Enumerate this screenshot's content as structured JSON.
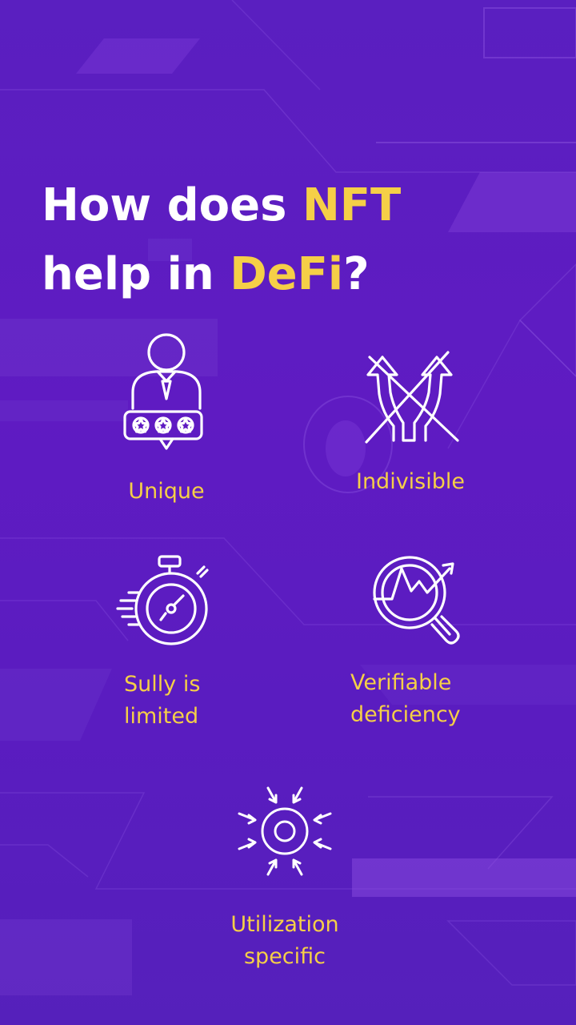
{
  "title": {
    "part1": "How does ",
    "highlight1": "NFT",
    "part2": "help in ",
    "highlight2": "DeFi",
    "part3": "?"
  },
  "features": [
    {
      "label": "Unique",
      "icon": "person-rating-icon"
    },
    {
      "label": "Indivisible",
      "icon": "crossed-arrows-icon"
    },
    {
      "label": "Sully is\nlimited",
      "icon": "stopwatch-icon"
    },
    {
      "label": "Verifiable\ndeficiency",
      "icon": "magnifier-chart-icon"
    },
    {
      "label": "Utilization\nspecific",
      "icon": "target-focus-icon"
    }
  ],
  "colors": {
    "background": "#5a1fc0",
    "title_text": "#ffffff",
    "accent": "#f5cf47",
    "icon_stroke": "#ffffff"
  }
}
